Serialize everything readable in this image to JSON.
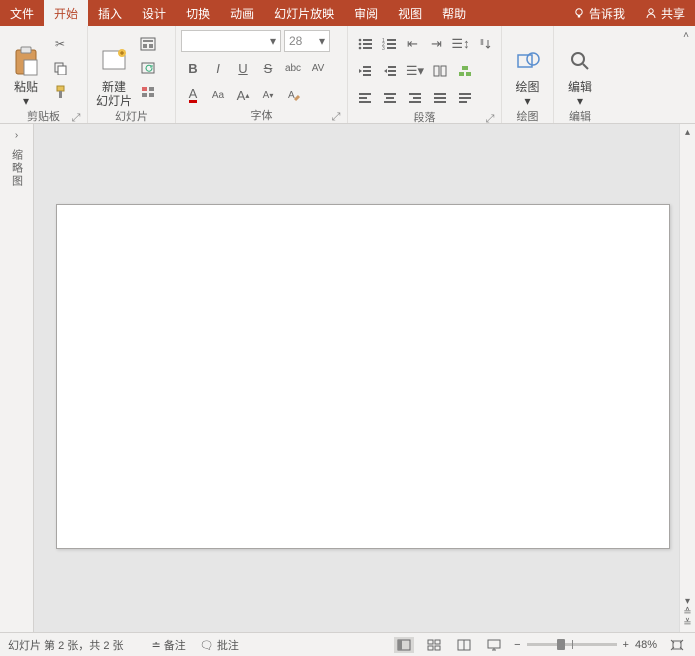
{
  "tabs": {
    "items": [
      "文件",
      "开始",
      "插入",
      "设计",
      "切换",
      "动画",
      "幻灯片放映",
      "审阅",
      "视图",
      "帮助"
    ],
    "activeIndex": 1,
    "tellMe": "告诉我",
    "share": "共享"
  },
  "ribbon": {
    "clipboard": {
      "label": "剪贴板",
      "paste": "粘贴"
    },
    "slides": {
      "label": "幻灯片",
      "newSlide": "新建\n幻灯片"
    },
    "font": {
      "label": "字体",
      "fontName": "",
      "fontSize": "28",
      "buttons": {
        "bold": "B",
        "italic": "I",
        "underline": "U",
        "strike": "S",
        "shadow": "abc",
        "spacing": "AV",
        "fontColor": "A",
        "changeCase": "Aa",
        "grow": "A",
        "shrink": "A",
        "clear": "A"
      }
    },
    "para": {
      "label": "段落"
    },
    "drawing": {
      "label": "绘图",
      "draw": "绘图"
    },
    "editing": {
      "label": "编辑",
      "edit": "编辑"
    }
  },
  "side": {
    "thumbsLabel": "缩略图"
  },
  "status": {
    "slideInfo": "幻灯片 第 2 张，共 2 张",
    "lang": "",
    "notes": "备注",
    "comments": "批注",
    "zoom": "48%"
  }
}
